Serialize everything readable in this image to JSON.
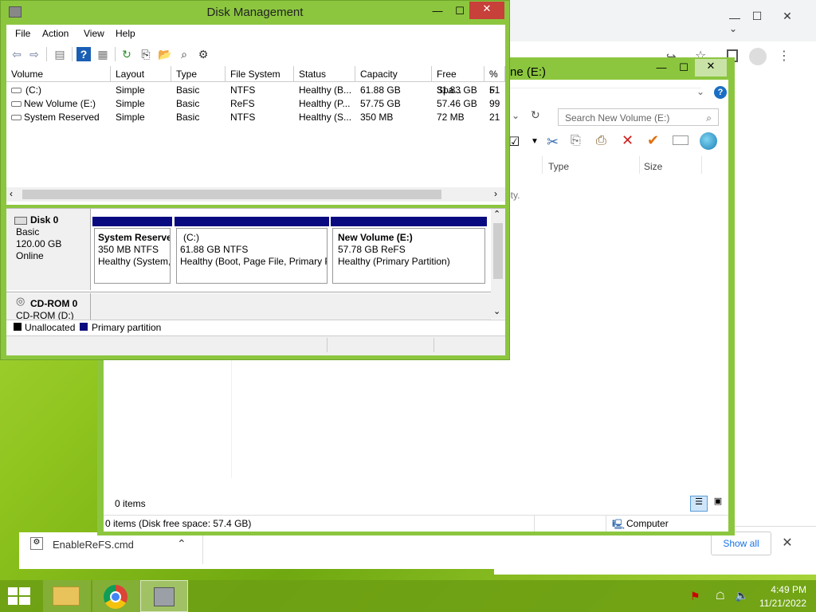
{
  "colors": {
    "accent_window": "#8cc63f",
    "partition_bar": "#0a0a80",
    "unallocated": "#000000"
  },
  "chrome": {
    "controls": [
      "▁",
      "☐",
      "✕"
    ],
    "download": {
      "filename": "EnableReFS.cmd",
      "show_all": "Show all"
    }
  },
  "explorer": {
    "title": "ne (E:)",
    "search_placeholder": "Search New Volume (E:)",
    "columns": [
      "d",
      "Type",
      "Size"
    ],
    "empty_text": "pty.",
    "items_count": "0 items",
    "status_left": "0 items (Disk free space: 57.4 GB)",
    "status_right": "Computer"
  },
  "dm": {
    "title": "Disk Management",
    "menu": [
      "File",
      "Action",
      "View",
      "Help"
    ],
    "columns": [
      "Volume",
      "Layout",
      "Type",
      "File System",
      "Status",
      "Capacity",
      "Free Spa...",
      "% F"
    ],
    "rows": [
      {
        "volume": "(C:)",
        "layout": "Simple",
        "type": "Basic",
        "fs": "NTFS",
        "status": "Healthy (B...",
        "capacity": "61.88 GB",
        "free": "31.83 GB",
        "pct": "51"
      },
      {
        "volume": "New Volume (E:)",
        "layout": "Simple",
        "type": "Basic",
        "fs": "ReFS",
        "status": "Healthy (P...",
        "capacity": "57.75 GB",
        "free": "57.46 GB",
        "pct": "99"
      },
      {
        "volume": "System Reserved",
        "layout": "Simple",
        "type": "Basic",
        "fs": "NTFS",
        "status": "Healthy (S...",
        "capacity": "350 MB",
        "free": "72 MB",
        "pct": "21"
      }
    ],
    "disk0": {
      "name": "Disk 0",
      "type": "Basic",
      "size": "120.00 GB",
      "state": "Online"
    },
    "partitions": [
      {
        "name": "System Reserve",
        "size": "350 MB NTFS",
        "status": "Healthy (System,"
      },
      {
        "name": "(C:)",
        "size": "61.88 GB NTFS",
        "status": "Healthy (Boot, Page File, Primary P"
      },
      {
        "name": "New Volume  (E:)",
        "size": "57.78 GB ReFS",
        "status": "Healthy (Primary Partition)"
      }
    ],
    "cdrom": {
      "name": "CD-ROM 0",
      "drive": "CD-ROM (D:)"
    },
    "legend": {
      "unallocated": "Unallocated",
      "primary": "Primary partition"
    }
  },
  "taskbar": {
    "time": "4:49 PM",
    "date": "11/21/2022"
  }
}
